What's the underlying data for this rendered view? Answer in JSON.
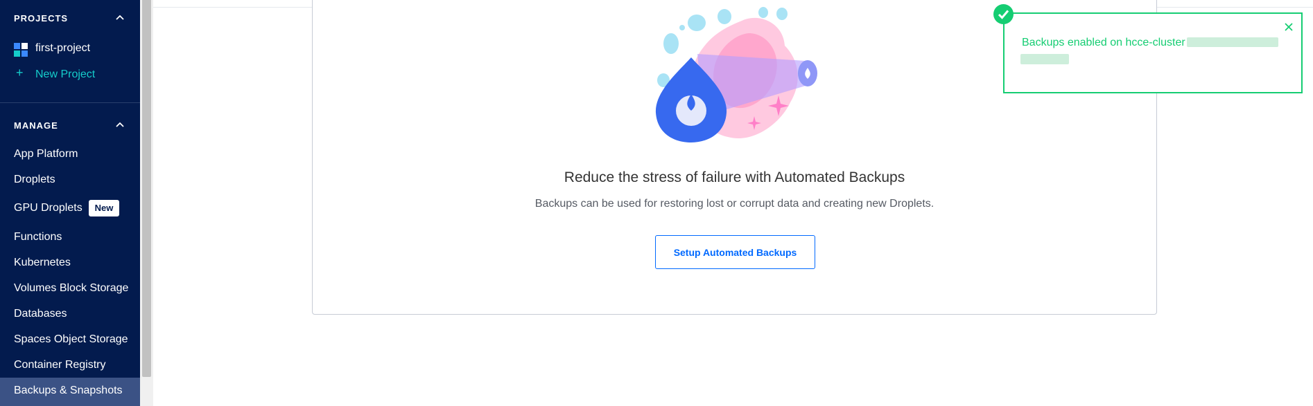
{
  "sidebar": {
    "projects_header": "PROJECTS",
    "projects": [
      {
        "name": "first-project"
      }
    ],
    "new_project_label": "New Project",
    "manage_header": "MANAGE",
    "items": [
      {
        "label": "App Platform"
      },
      {
        "label": "Droplets"
      },
      {
        "label": "GPU Droplets",
        "badge": "New"
      },
      {
        "label": "Functions"
      },
      {
        "label": "Kubernetes"
      },
      {
        "label": "Volumes Block Storage"
      },
      {
        "label": "Databases"
      },
      {
        "label": "Spaces Object Storage"
      },
      {
        "label": "Container Registry"
      },
      {
        "label": "Backups & Snapshots",
        "active": true
      }
    ]
  },
  "main": {
    "empty_state": {
      "headline": "Reduce the stress of failure with Automated Backups",
      "description": "Backups can be used for restoring lost or corrupt data and creating new Droplets.",
      "button_label": "Setup Automated Backups"
    }
  },
  "toast": {
    "message": "Backups enabled on hcce-cluster",
    "status": "success"
  },
  "colors": {
    "sidebar_bg": "#031b4e",
    "accent_teal": "#15cdcb",
    "primary_blue": "#0069ff",
    "success_green": "#15cd72"
  }
}
